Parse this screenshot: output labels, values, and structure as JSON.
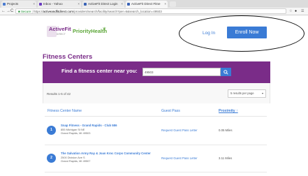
{
  "browser": {
    "tabs": [
      {
        "label": "Projects",
        "favicon_color": "#4a7bd0"
      },
      {
        "label": "Inbox - Yahoo",
        "favicon_color": "#6a3bc0"
      },
      {
        "label": "ActiveFit Direct Login",
        "favicon_color": "#3a63b5"
      },
      {
        "label": "ActiveFit Direct Fitne",
        "favicon_color": "#3a63b5"
      }
    ],
    "url": {
      "secure_label": "Secure",
      "protocol": "https://",
      "host": "activeandfitdirect.com",
      "path": "/providers/search/facility/search?per=6&search_location=49503"
    },
    "extensions": [
      "star-icon",
      "circle-icon",
      "menu-icon"
    ]
  },
  "header": {
    "logo_active": "ActiveFit",
    "logo_tagline": "DIRECT",
    "logo_partner": "PriorityHealth",
    "login_label": "Log In",
    "enroll_label": "Enroll Now"
  },
  "main": {
    "title": "Fitness Centers",
    "search": {
      "label": "Find a fitness center near you:",
      "value": "49503"
    },
    "results": {
      "count_text": "Results 1-5 of 42",
      "per_page": "5 results per page"
    },
    "table": {
      "headers": {
        "name": "Fitness Center Name",
        "pass": "Guest Pass",
        "proximity": "Proximity ↑"
      },
      "rows": [
        {
          "num": "1",
          "name": "Snap Fitness - Grand Rapids - Club 586",
          "addr1": "855 Michigan St NE",
          "addr2": "Grand Rapids, MI 49503",
          "pass": "Request Guest Pass Letter",
          "distance": "0.05 Miles"
        },
        {
          "num": "2",
          "name": "The Salvation Army Ray & Joan Kroc Corps Community Center",
          "addr1": "2500 Division Ave S",
          "addr2": "Grand Rapids, MI 49507",
          "pass": "Request Guest Pass Letter",
          "distance": "3.11 Miles"
        }
      ]
    }
  },
  "colors": {
    "brand_purple": "#7a2c88",
    "brand_green": "#5ca638",
    "accent_blue": "#3a7bd5"
  }
}
